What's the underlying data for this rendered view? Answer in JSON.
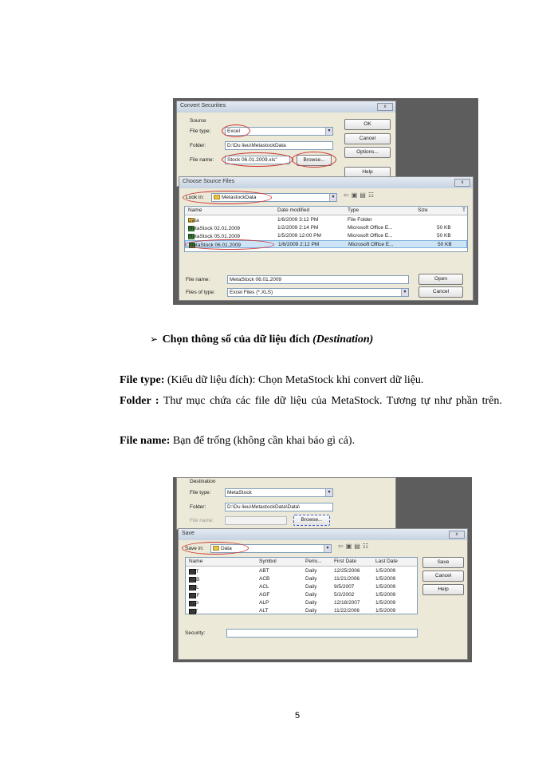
{
  "screenshot1": {
    "convert_dialog": {
      "title": "Convert Securities",
      "close": "x",
      "source_group": "Source",
      "file_type_label": "File type:",
      "file_type_value": "Excel",
      "folder_label": "Folder:",
      "folder_value": "D:\\Du lieu\\MetastockData",
      "file_name_label": "File name:",
      "file_name_value": "Stock 06.01.2009.xls\"",
      "browse": "Browse...",
      "ok": "OK",
      "cancel": "Cancel",
      "options": "Options...",
      "help": "Help"
    },
    "choose_dialog": {
      "title": "Choose Source Files",
      "close": "x",
      "look_in_label": "Look in:",
      "look_in_value": "MetastockData",
      "columns": [
        "Name",
        "Date modified",
        "Type",
        "Size",
        "T"
      ],
      "rows": [
        {
          "name": "Data",
          "date": "1/6/2009 3:12 PM",
          "type": "File Folder",
          "size": "",
          "icon": "folder-icon"
        },
        {
          "name": "MetaStock 02.01.2009",
          "date": "1/2/2009 2:14 PM",
          "type": "Microsoft Office E...",
          "size": "50 KB",
          "icon": "excel-file-icon"
        },
        {
          "name": "MetaStock 05.01.2009",
          "date": "1/5/2009 12:00 PM",
          "type": "Microsoft Office E...",
          "size": "50 KB",
          "icon": "excel-file-icon"
        },
        {
          "name": "MetaStock 06.01.2009",
          "date": "1/6/2009 2:12 PM",
          "type": "Microsoft Office E...",
          "size": "50 KB",
          "icon": "excel-file-icon"
        }
      ],
      "file_name_label": "File name:",
      "file_name_value": "MetaStock 06.01.2009",
      "files_of_type_label": "Files of type:",
      "files_of_type_value": "Excel Files (*.XLS)",
      "open": "Open",
      "cancel": "Cancel"
    }
  },
  "text": {
    "heading_arrow": "➢",
    "heading_main": "Chọn thông số của dữ liệu đích",
    "heading_italic": "(Destination)",
    "p1_bold": "File type:",
    "p1_rest": " (Kiểu dữ liệu đích): Chọn MetaStock khi convert dữ liệu.",
    "p2_bold": "Folder :",
    "p2_rest": " Thư mục chứa các file dữ liệu của MetaStock. Tương tự như phần trên.",
    "p3_bold": "File name:",
    "p3_rest": " Bạn để trống (không cần khai báo gì cả)."
  },
  "screenshot2": {
    "destination_panel": {
      "group": "Destination",
      "file_type_label": "File type:",
      "file_type_value": "MetaStock",
      "folder_label": "Folder:",
      "folder_value": "D:\\Du lieu\\MetastockData\\Data\\",
      "file_name_label": "File name:",
      "browse": "Browse..."
    },
    "save_dialog": {
      "title": "Save",
      "close": "x",
      "save_in_label": "Save in:",
      "save_in_value": "Data",
      "columns": [
        "Name",
        "Symbol",
        "Perio...",
        "First Date",
        "Last Date"
      ],
      "rows": [
        {
          "name": "ABT",
          "symbol": "ABT",
          "period": "Daily",
          "first": "12/25/2006",
          "last": "1/5/2009"
        },
        {
          "name": "ACB",
          "symbol": "ACB",
          "period": "Daily",
          "first": "11/21/2006",
          "last": "1/5/2009"
        },
        {
          "name": "ACL",
          "symbol": "ACL",
          "period": "Daily",
          "first": "9/5/2007",
          "last": "1/5/2009"
        },
        {
          "name": "AGF",
          "symbol": "AGF",
          "period": "Daily",
          "first": "5/2/2002",
          "last": "1/5/2009"
        },
        {
          "name": "ALP",
          "symbol": "ALP",
          "period": "Daily",
          "first": "12/18/2007",
          "last": "1/5/2009"
        },
        {
          "name": "ALT",
          "symbol": "ALT",
          "period": "Daily",
          "first": "11/22/2006",
          "last": "1/5/2009"
        }
      ],
      "save": "Save",
      "cancel": "Cancel",
      "help": "Help",
      "security_label": "Security:"
    }
  },
  "page_number": "5"
}
